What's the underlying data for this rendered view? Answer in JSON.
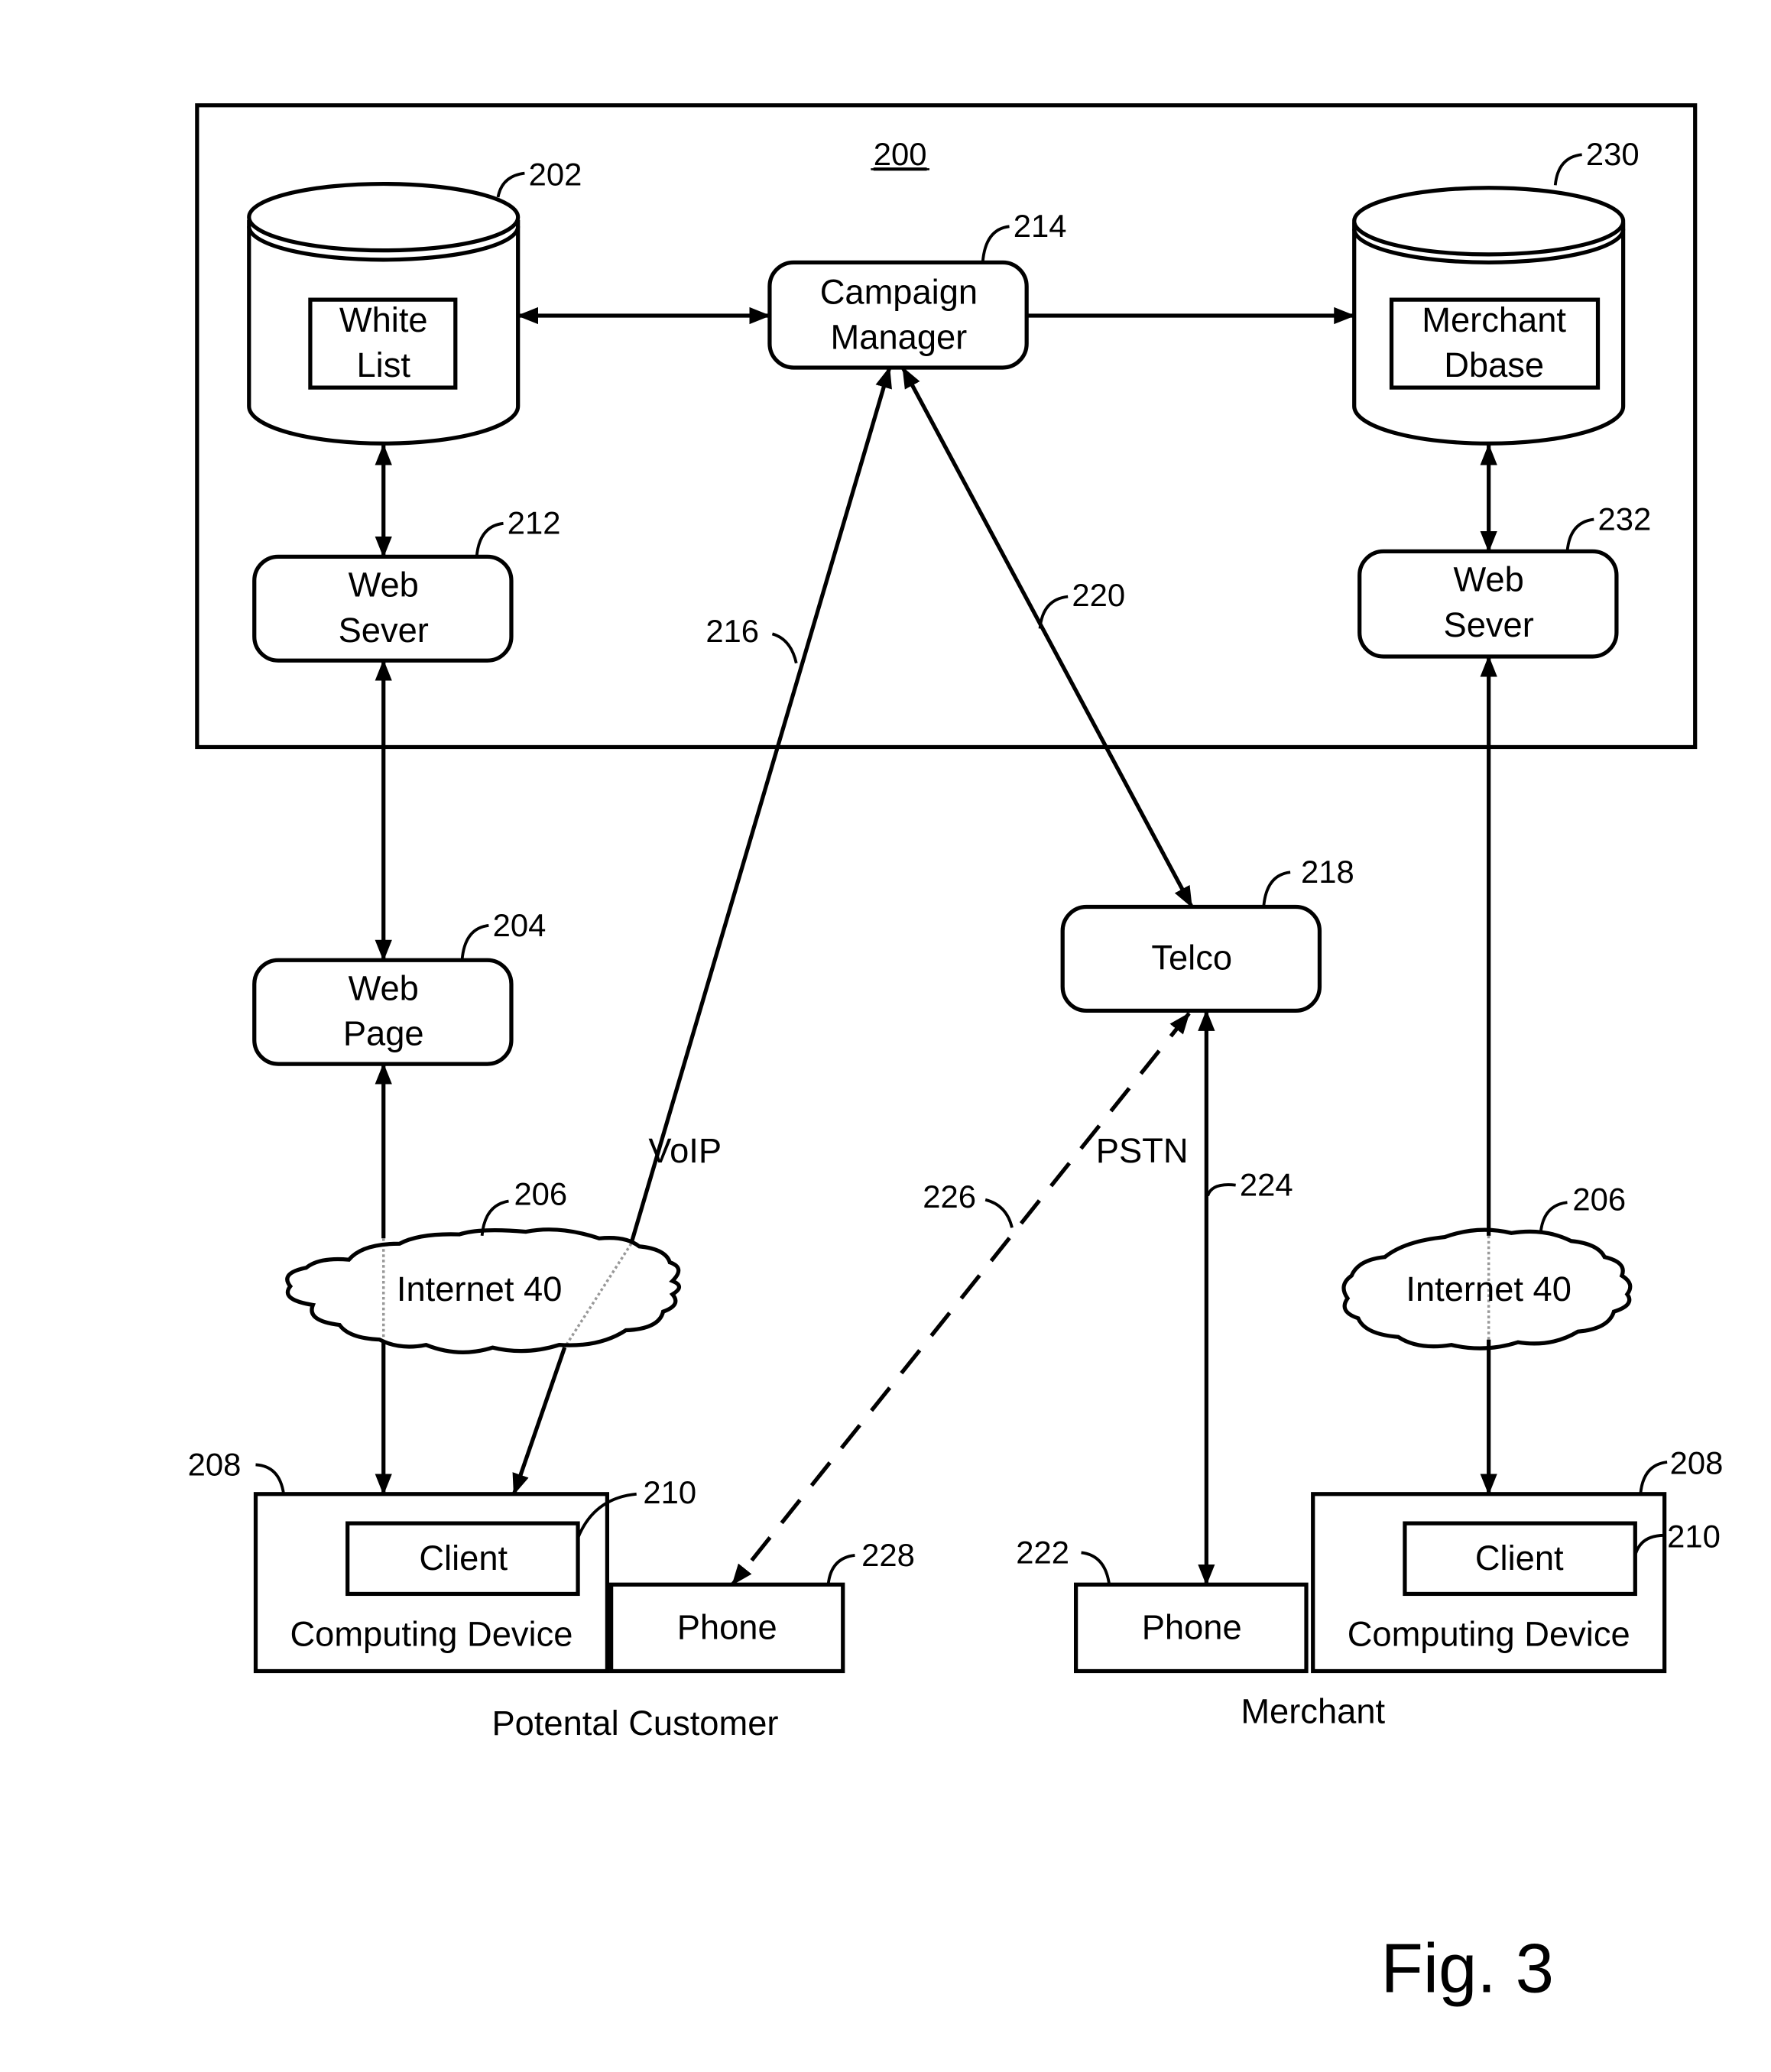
{
  "system": {
    "ref": "200"
  },
  "nodes": {
    "white_list_db": {
      "ref": "202",
      "line1": "White",
      "line2": "List"
    },
    "campaign_manager": {
      "ref": "214",
      "line1": "Campaign",
      "line2": "Manager"
    },
    "merchant_db": {
      "ref": "230",
      "line1": "Merchant",
      "line2": "Dbase"
    },
    "web_server_left": {
      "ref": "212",
      "line1": "Web",
      "line2": "Sever"
    },
    "web_server_right": {
      "ref": "232",
      "line1": "Web",
      "line2": "Sever"
    },
    "web_page": {
      "ref": "204",
      "line1": "Web",
      "line2": "Page"
    },
    "telco": {
      "ref": "218",
      "label": "Telco"
    },
    "internet_left": {
      "ref": "206",
      "label": "Internet 40"
    },
    "internet_right": {
      "ref": "206",
      "label": "Internet 40"
    },
    "customer_device": {
      "ref": "208",
      "label": "Computing Device",
      "client_ref": "210",
      "client_label": "Client"
    },
    "customer_phone": {
      "ref": "228",
      "label": "Phone"
    },
    "merchant_phone": {
      "ref": "222",
      "label": "Phone"
    },
    "merchant_device": {
      "ref": "208",
      "label": "Computing Device",
      "client_ref": "210",
      "client_label": "Client"
    }
  },
  "links": {
    "voip": {
      "ref": "216",
      "label": "VoIP"
    },
    "cm_telco": {
      "ref": "220"
    },
    "pstn": {
      "ref": "224",
      "label": "PSTN"
    },
    "dashed_call": {
      "ref": "226"
    }
  },
  "groups": {
    "customer": "Potental Customer",
    "merchant": "Merchant"
  },
  "figure_label": "Fig. 3"
}
